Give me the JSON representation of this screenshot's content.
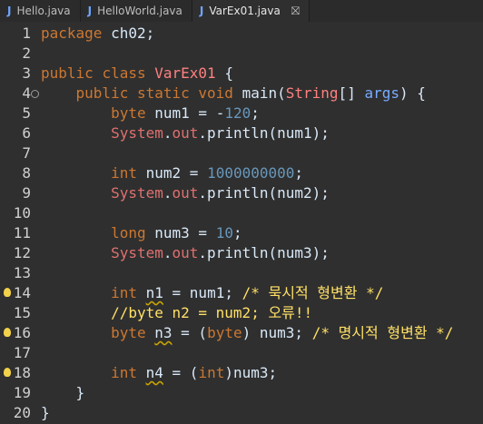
{
  "tabs": [
    {
      "label": "Hello.java",
      "active": false
    },
    {
      "label": "HelloWorld.java",
      "active": false
    },
    {
      "label": "VarEx01.java",
      "active": true
    }
  ],
  "close_glyph": "⛝",
  "lines": [
    {
      "n": "1",
      "code": "package ch02;"
    },
    {
      "n": "2",
      "code": ""
    },
    {
      "n": "3",
      "code": "public class VarEx01 {"
    },
    {
      "n": "4",
      "code": "    public static void main(String[] args) {"
    },
    {
      "n": "5",
      "code": "        byte num1 = -120;"
    },
    {
      "n": "6",
      "code": "        System.out.println(num1);"
    },
    {
      "n": "7",
      "code": ""
    },
    {
      "n": "8",
      "code": "        int num2 = 1000000000;"
    },
    {
      "n": "9",
      "code": "        System.out.println(num2);"
    },
    {
      "n": "10",
      "code": ""
    },
    {
      "n": "11",
      "code": "        long num3 = 10;"
    },
    {
      "n": "12",
      "code": "        System.out.println(num3);"
    },
    {
      "n": "13",
      "code": ""
    },
    {
      "n": "14",
      "code": "        int n1 = num1; /* 묵시적 형변환 */"
    },
    {
      "n": "15",
      "code": "        //byte n2 = num2; 오류!!"
    },
    {
      "n": "16",
      "code": "        byte n3 = (byte) num3; /* 명시적 형변환 */"
    },
    {
      "n": "17",
      "code": ""
    },
    {
      "n": "18",
      "code": "        int n4 = (int)num3;"
    },
    {
      "n": "19",
      "code": "    }"
    },
    {
      "n": "20",
      "code": "}"
    }
  ],
  "colors": {
    "keyword": "#cc7832",
    "type": "#1290c3",
    "classname": "#ff8080",
    "system": "#e07070",
    "number": "#6897bb",
    "comment": "#ffe066",
    "identifier": "#d9e8f7"
  }
}
